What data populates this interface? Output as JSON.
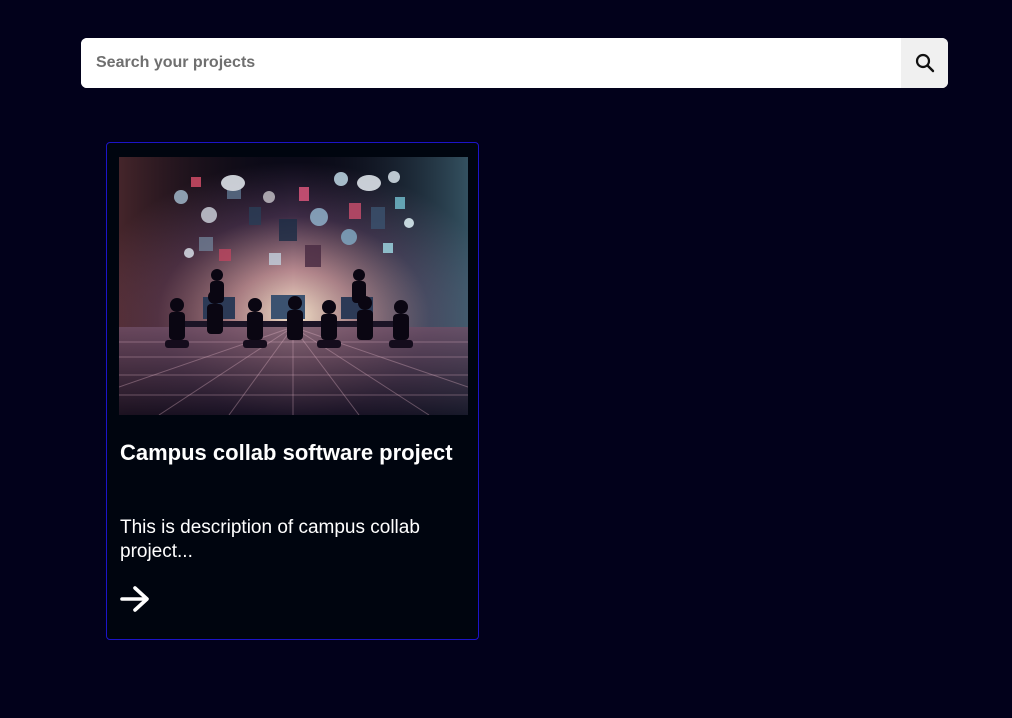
{
  "search": {
    "placeholder": "Search your projects",
    "button_icon": "search-icon"
  },
  "projects": [
    {
      "title": "Campus collab software project",
      "description": "This is description of campus collab project...",
      "link_icon": "arrow-right-icon"
    }
  ],
  "colors": {
    "background": "#02011b",
    "card_border": "#1c14c8",
    "card_background": "#00050f",
    "text": "#ffffff"
  }
}
